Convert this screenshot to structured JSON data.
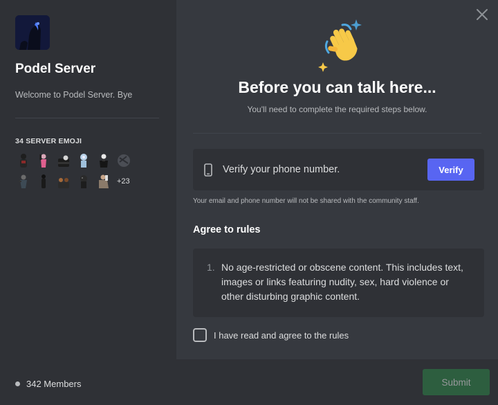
{
  "server": {
    "name": "Podel Server",
    "description": "Welcome to Podel Server. Bye",
    "emoji_header": "34 SERVER EMOJI",
    "emoji_more": "+23",
    "members": "342 Members"
  },
  "main": {
    "title": "Before you can talk here...",
    "subtitle": "You'll need to complete the required steps below.",
    "verify_text": "Verify your phone number.",
    "verify_button": "Verify",
    "privacy_note": "Your email and phone number will not be shared with the community staff.",
    "rules_heading": "Agree to rules",
    "rules": [
      {
        "num": "1.",
        "text": "No age-restricted or obscene content. This includes text, images or links featuring nudity, sex, hard violence or other disturbing graphic content."
      }
    ],
    "agree_label": "I have read and agree to the rules",
    "submit_button": "Submit"
  },
  "icons": {
    "close": "close-icon",
    "wave": "waving-hand-icon",
    "phone": "phone-icon"
  },
  "colors": {
    "sidebar_bg": "#2f3136",
    "main_bg": "#36393f",
    "accent": "#5865f2",
    "submit_green": "#2d7d46"
  }
}
